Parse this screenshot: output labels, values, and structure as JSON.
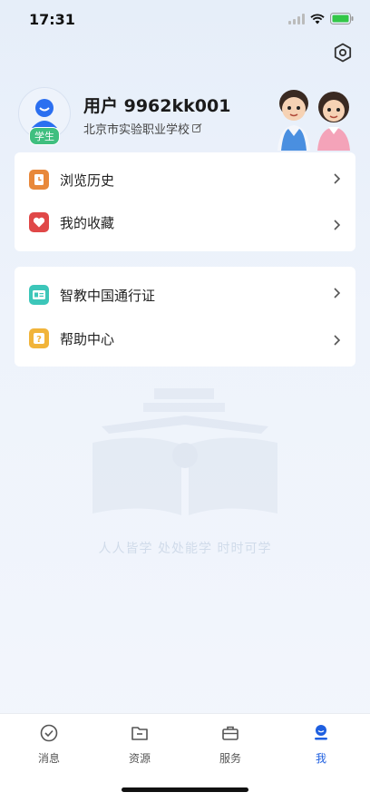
{
  "status": {
    "time": "17:31"
  },
  "profile": {
    "username": "用户 9962kk001",
    "school": "北京市实验职业学校",
    "role_badge": "学生"
  },
  "menu_group_1": [
    {
      "label": "浏览历史",
      "icon": "history-icon",
      "color": "#e8883a"
    },
    {
      "label": "我的收藏",
      "icon": "heart-icon",
      "color": "#e04848"
    }
  ],
  "menu_group_2": [
    {
      "label": "智教中国通行证",
      "icon": "id-card-icon",
      "color": "#3cc6b9"
    },
    {
      "label": "帮助中心",
      "icon": "help-icon",
      "color": "#f1b43a"
    }
  ],
  "watermark": {
    "slogan": "人人皆学 处处能学 时时可学"
  },
  "tabs": [
    {
      "label": "消息",
      "icon": "message-check-icon"
    },
    {
      "label": "资源",
      "icon": "folder-icon"
    },
    {
      "label": "服务",
      "icon": "briefcase-icon"
    },
    {
      "label": "我",
      "icon": "person-icon",
      "active": true
    }
  ],
  "colors": {
    "accent": "#1e5fe0",
    "badge": "#3fbf7f"
  }
}
